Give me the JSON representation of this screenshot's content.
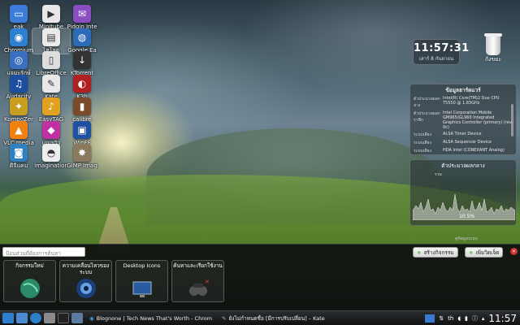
{
  "desktop_icons": [
    {
      "label": "eak",
      "icon": "folder-icon",
      "color": "#3b7dd8",
      "glyph": "▭"
    },
    {
      "label": "Minitube",
      "icon": "minitube-icon",
      "color": "#e8e8e8",
      "glyph": "▶"
    },
    {
      "label": "Pidgin Inte",
      "icon": "pidgin-icon",
      "color": "#8a4ec0",
      "glyph": "✉"
    },
    {
      "label": "Chromium",
      "icon": "chromium-icon",
      "color": "#2f7fd0",
      "glyph": "◉"
    },
    {
      "label": "ไฮโลตู",
      "icon": "doc-icon",
      "color": "#eaeaea",
      "glyph": "▤"
    },
    {
      "label": "Google Ea",
      "icon": "google-earth-icon",
      "color": "#2d6ab8",
      "glyph": "◍"
    },
    {
      "label": "แจมะรักษ์",
      "icon": "globe-icon",
      "color": "#3a6fc0",
      "glyph": "◎"
    },
    {
      "label": "LibreOffice",
      "icon": "libreoffice-icon",
      "color": "#ddd",
      "glyph": "▯"
    },
    {
      "label": "KTorrent",
      "icon": "ktorrent-icon",
      "color": "#333",
      "glyph": "↓"
    },
    {
      "label": "Audacity",
      "icon": "audacity-icon",
      "color": "#1c4fa0",
      "glyph": "♫"
    },
    {
      "label": "Kate",
      "icon": "kate-icon",
      "color": "#e8e8e8",
      "glyph": "✎"
    },
    {
      "label": "K3b",
      "icon": "k3b-icon",
      "color": "#b02020",
      "glyph": "◐"
    },
    {
      "label": "KompoZer",
      "icon": "kompozer-icon",
      "color": "#c89e20",
      "glyph": "✦"
    },
    {
      "label": "EasyTAG",
      "icon": "easytag-icon",
      "color": "#e0a020",
      "glyph": "♪"
    },
    {
      "label": "calibre",
      "icon": "calibre-icon",
      "color": "#7a4a2a",
      "glyph": "▮"
    },
    {
      "label": "VLC media",
      "icon": "vlc-icon",
      "color": "#f08010",
      "glyph": "▲"
    },
    {
      "label": "เกมรวิว",
      "icon": "game-icon",
      "color": "#c030a0",
      "glyph": "◆"
    },
    {
      "label": "WinFF",
      "icon": "winff-icon",
      "color": "#2050a0",
      "glyph": "▣"
    },
    {
      "label": "ดีจีแคม",
      "icon": "camera-icon",
      "color": "#3080c0",
      "glyph": "◙"
    },
    {
      "label": "Imagination",
      "icon": "imagination-icon",
      "color": "#eee",
      "glyph": "◓"
    },
    {
      "label": "GIMP Imag",
      "icon": "gimp-icon",
      "color": "#8a7a60",
      "glyph": "✸"
    }
  ],
  "clock_widget": {
    "time": "11:57:31",
    "date": "เสาร์ 8 กันยายน"
  },
  "trash": {
    "label": "ถังขยะ"
  },
  "system_info": {
    "title": "ข้อมูลฮาร์ดแวร์",
    "rows": [
      {
        "k": "ตัวประมวลผลกลาง",
        "v": "Intel(R) Core(TM)2 Duo CPU T5550 @ 1.83GHz"
      },
      {
        "k": "ตัวประมวลผลกราฟิก",
        "v": "Intel Corporation Mobile GM965/GL960 Integrated Graphics Controller (primary) (rev 0c)"
      },
      {
        "k": "ระบบเสียง",
        "v": "ALSA Timer Device"
      },
      {
        "k": "ระบบเสียง",
        "v": "ALSA Sequencer Device"
      },
      {
        "k": "ระบบเสียง",
        "v": "HDA Intel (CONEXANT Analog)"
      }
    ]
  },
  "cpu_monitor": {
    "title": "ตัวประมวลผลกลาง",
    "sub": "รวม",
    "percent": "10.5%",
    "footer": "ดูข้อมูลระบบ"
  },
  "activity_search": {
    "placeholder": "ป้อนส่วนที่ต้องการค้นหา"
  },
  "buttons": {
    "create": "สร้างกิจกรรม",
    "add": "เพิ่มวิดเจ็ต"
  },
  "activities": [
    {
      "title": "กิจกรรมใหม่",
      "icon": "globe-activity-icon"
    },
    {
      "title": "ความเคลื่อนไหวของระบบ",
      "icon": "camera-activity-icon"
    },
    {
      "title": "Desktop Icons",
      "icon": "desktop-activity-icon"
    },
    {
      "title": "ค้นหาและเรียกใช้งาน",
      "icon": "binoculars-activity-icon"
    }
  ],
  "taskbar": {
    "tasks": [
      {
        "label": "Blognone | Tech News That's Worth - Chrom"
      },
      {
        "label": "ยังไม่กำหนดชื่อ [มีการปรับเปลี่ยน] – Kate"
      }
    ],
    "tray": {
      "keyboard": "th",
      "time": "11:57"
    }
  },
  "colors": {
    "panel": "#0a0c0e",
    "accent": "#2f7fd0"
  }
}
